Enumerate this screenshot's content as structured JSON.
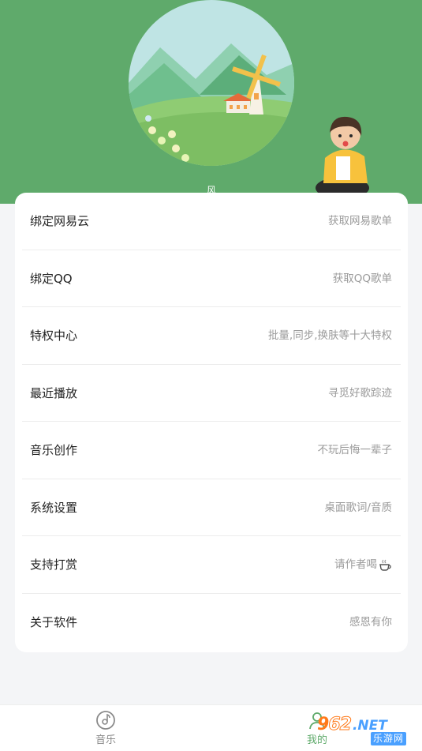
{
  "colors": {
    "brand_green": "#5faa6b",
    "card_bg": "#ffffff",
    "page_bg": "#f4f5f7",
    "label_text": "#222222",
    "hint_text": "#9a9a9a"
  },
  "header": {
    "cover_art": "landscape-windmill-illustration",
    "small_label": "风",
    "figure": "cartoon-boy-sitting-figure"
  },
  "menu": {
    "items": [
      {
        "label": "绑定网易云",
        "hint": "获取网易歌单"
      },
      {
        "label": "绑定QQ",
        "hint": "获取QQ歌单"
      },
      {
        "label": "特权中心",
        "hint": "批量,同步,换肤等十大特权"
      },
      {
        "label": "最近播放",
        "hint": "寻觅好歌踪迹"
      },
      {
        "label": "音乐创作",
        "hint": "不玩后悔一辈子"
      },
      {
        "label": "系统设置",
        "hint": "桌面歌词/音质"
      },
      {
        "label": "支持打赏",
        "hint": "请作者喝",
        "hint_icon": "coffee-cup-icon"
      },
      {
        "label": "关于软件",
        "hint": "感恩有你"
      }
    ]
  },
  "tabbar": {
    "music": {
      "label": "音乐",
      "icon": "music-disc-icon"
    },
    "mine": {
      "label": "我的",
      "icon": "person-icon"
    }
  },
  "watermark": {
    "digits_a": "9",
    "digits_b": "62",
    "suffix": ".NET",
    "caption": "乐游网"
  }
}
